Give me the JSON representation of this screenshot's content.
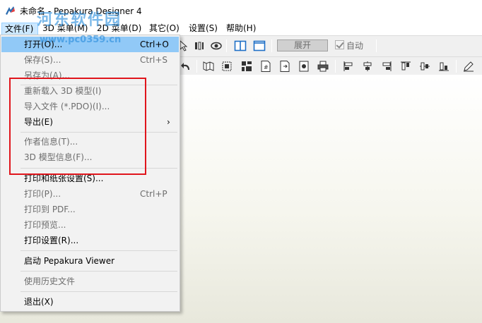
{
  "window": {
    "title": "未命名 - Pepakura Designer 4",
    "watermark": "河东软件园",
    "watermark_url": "www.pc0359.cn"
  },
  "menubar": [
    {
      "label": "文件(F)"
    },
    {
      "label": "3D 菜单(M)"
    },
    {
      "label": "2D 菜单(D)"
    },
    {
      "label": "其它(O)"
    },
    {
      "label": "设置(S)"
    },
    {
      "label": "帮助(H)"
    }
  ],
  "toolbar": {
    "expand_label": "展开",
    "auto_label": "自动",
    "auto_checked": true
  },
  "file_menu": {
    "items": [
      {
        "label": "打开(O)...",
        "accel": "Ctrl+O",
        "state": "highlighted"
      },
      {
        "label": "保存(S)...",
        "accel": "Ctrl+S",
        "state": "disabled"
      },
      {
        "label": "另存为(A)...",
        "accel": "",
        "state": "disabled"
      },
      {
        "label": "重新载入 3D 模型(I)",
        "accel": "",
        "state": "disabled"
      },
      {
        "label": "导入文件 (*.PDO)(I)...",
        "accel": "",
        "state": "disabled"
      },
      {
        "label": "导出(E)",
        "accel": "",
        "state": "enabled",
        "submenu": true
      },
      {
        "label": "作者信息(T)...",
        "accel": "",
        "state": "disabled"
      },
      {
        "label": "3D 模型信息(F)...",
        "accel": "",
        "state": "disabled"
      },
      {
        "label": "打印和纸张设置(S)...",
        "accel": "",
        "state": "enabled"
      },
      {
        "label": "打印(P)...",
        "accel": "Ctrl+P",
        "state": "disabled"
      },
      {
        "label": "打印到 PDF...",
        "accel": "",
        "state": "disabled"
      },
      {
        "label": "打印预览...",
        "accel": "",
        "state": "disabled"
      },
      {
        "label": "打印设置(R)...",
        "accel": "",
        "state": "enabled"
      },
      {
        "label": "启动 Pepakura Viewer",
        "accel": "",
        "state": "enabled"
      },
      {
        "label": "使用历史文件",
        "accel": "",
        "state": "disabled"
      },
      {
        "label": "退出(X)",
        "accel": "",
        "state": "enabled"
      }
    ],
    "submenu_arrow": "›"
  },
  "colors": {
    "highlight": "#91c9f7",
    "annotation_box": "#e0151c",
    "disabled_text": "#6d6d6d"
  }
}
